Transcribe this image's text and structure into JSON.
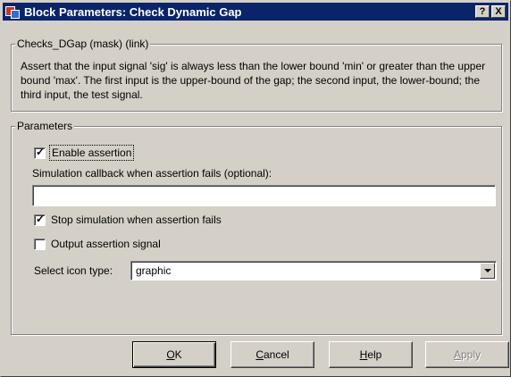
{
  "window": {
    "title": "Block Parameters: Check  Dynamic Gap",
    "help_btn": "?",
    "close_btn": "X"
  },
  "mask_group": {
    "title": "Checks_DGap (mask) (link)",
    "description": "Assert that the input signal 'sig' is always less than the lower bound 'min' or greater than the upper bound 'max'.  The first input is the upper-bound of the gap; the second input, the lower-bound; the third input, the test signal."
  },
  "params": {
    "title": "Parameters",
    "enable_assertion": {
      "label": "Enable assertion",
      "checked": true
    },
    "callback_label": "Simulation callback when assertion fails (optional):",
    "callback_value": "",
    "stop_simulation": {
      "label": "Stop simulation when assertion fails",
      "checked": true
    },
    "output_signal": {
      "label": "Output assertion signal",
      "checked": false
    },
    "icon_type_label": "Select icon type:",
    "icon_type_value": "graphic"
  },
  "buttons": {
    "ok": {
      "mnemonic": "O",
      "rest": "K"
    },
    "cancel": {
      "mnemonic": "C",
      "rest": "ancel"
    },
    "help": {
      "mnemonic": "H",
      "rest": "elp"
    },
    "apply": {
      "mnemonic": "A",
      "rest": "pply"
    }
  },
  "colors": {
    "titlebar": "#0a246a",
    "face": "#d4d0c8"
  }
}
